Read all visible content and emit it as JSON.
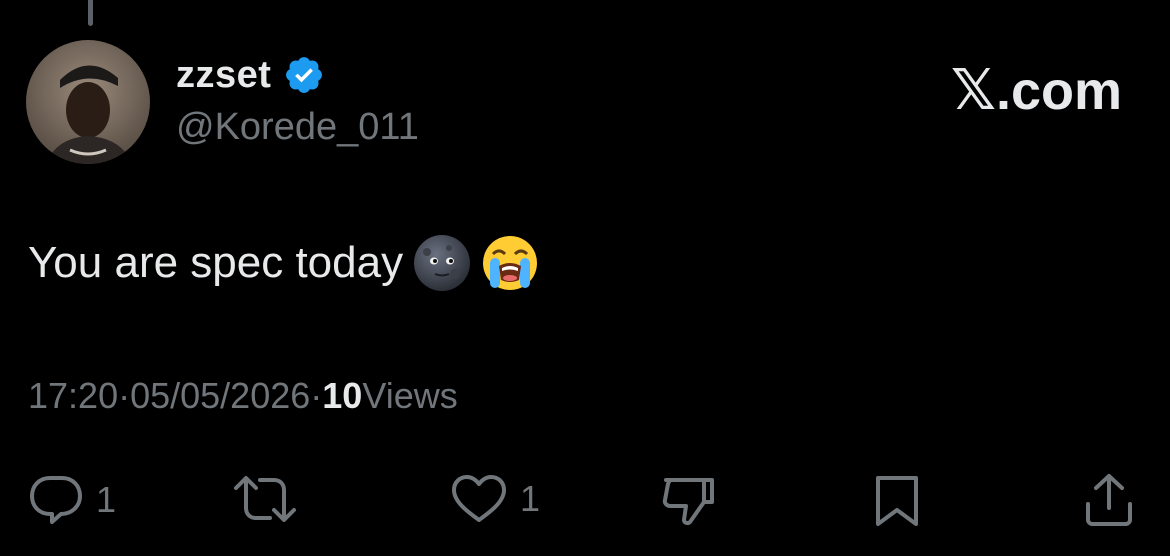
{
  "tweet": {
    "display_name": "zzset",
    "handle": "@Korede_011",
    "text": "You are spec today",
    "emojis": [
      "new-moon-face",
      "loudly-crying-face"
    ],
    "time": "17:20",
    "separator": " · ",
    "date": "05/05/2026",
    "views_count": "10",
    "views_label": " Views"
  },
  "brand": {
    "x_glyph": "𝕏",
    "suffix": ".com"
  },
  "actions": {
    "reply_count": "1",
    "like_count": "1"
  },
  "colors": {
    "background": "#000000",
    "text": "#e7e9ea",
    "muted": "#71767b",
    "verified": "#1d9bf0"
  }
}
